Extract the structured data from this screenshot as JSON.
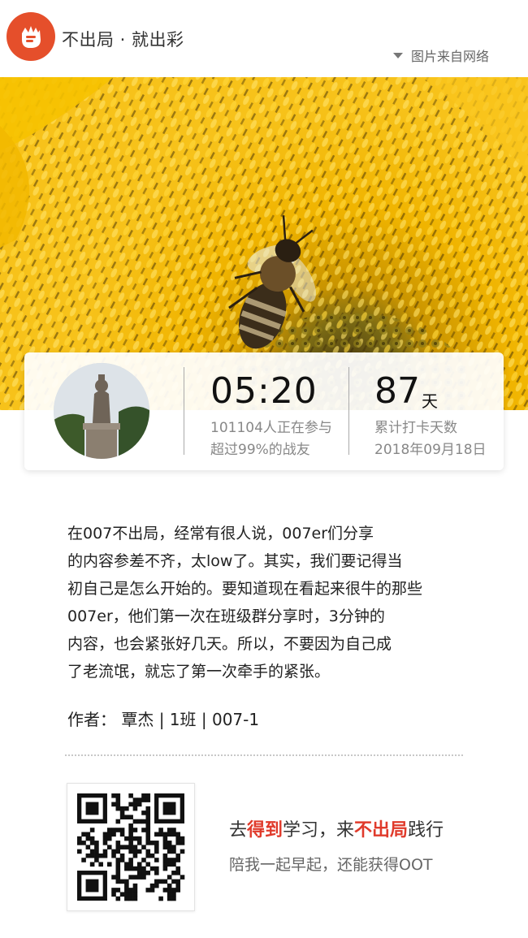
{
  "header": {
    "brand": "不出局 · 就出彩",
    "image_source": "图片来自网络"
  },
  "hero": {
    "icon": "sunflower-bee-photo"
  },
  "stats": {
    "time": "05:20",
    "participants": "101104人正在参与",
    "surpass": "超过99%的战友",
    "days_value": "87",
    "days_unit": "天",
    "days_label": "累计打卡天数",
    "date": "2018年09月18日"
  },
  "article": {
    "lines": [
      "在007不出局，经常有很人说，007er们分享",
      "的内容参差不齐，太low了。其实，我们要记得当",
      "初自己是怎么开始的。要知道现在看起来很牛的那些",
      "007er，他们第一次在班级群分享时，3分钟的",
      "内容，也会紧张好几天。所以，不要因为自己成",
      "了老流氓，就忘了第一次牵手的紧张。"
    ],
    "author": "作者： 覃杰 | 1班 | 007-1"
  },
  "footer": {
    "promo_part1": "去",
    "promo_hl1": "得到",
    "promo_part2": "学习，来",
    "promo_hl2": "不出局",
    "promo_part3": "践行",
    "promo_line2": "陪我一起早起，还能获得OOT"
  },
  "colors": {
    "brand_red": "#e54f2b",
    "highlight_red": "#e03a2b"
  }
}
